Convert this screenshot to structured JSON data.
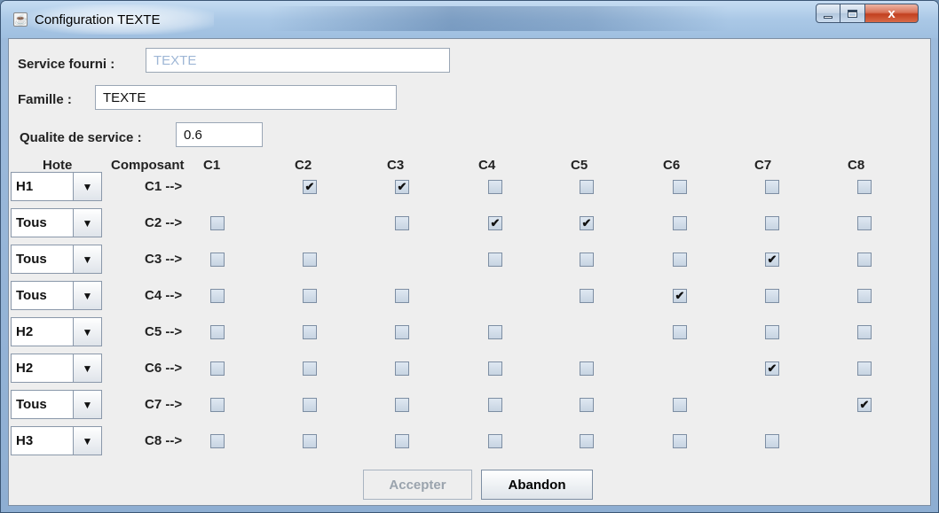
{
  "window": {
    "title": "Configuration TEXTE",
    "close_glyph": "x",
    "icons": [
      "java-app-icon",
      "minimize-icon",
      "maximize-icon",
      "close-icon"
    ]
  },
  "form": {
    "service_label": "Service fourni :",
    "service_value": "TEXTE",
    "famille_label": "Famille :",
    "famille_value": "TEXTE",
    "qualite_label": "Qualite de service :",
    "qualite_value": "0.6"
  },
  "grid": {
    "hote_header": "Hote",
    "composant_header": "Composant",
    "columns": [
      "C1",
      "C2",
      "C3",
      "C4",
      "C5",
      "C6",
      "C7",
      "C8"
    ],
    "rows": [
      {
        "hote": "H1",
        "label": "C1 -->",
        "checks": [
          null,
          true,
          true,
          false,
          false,
          false,
          false,
          false
        ]
      },
      {
        "hote": "Tous",
        "label": "C2 -->",
        "checks": [
          false,
          null,
          false,
          true,
          true,
          false,
          false,
          false
        ]
      },
      {
        "hote": "Tous",
        "label": "C3 -->",
        "checks": [
          false,
          false,
          null,
          false,
          false,
          false,
          true,
          false
        ]
      },
      {
        "hote": "Tous",
        "label": "C4 -->",
        "checks": [
          false,
          false,
          false,
          null,
          false,
          true,
          false,
          false
        ]
      },
      {
        "hote": "H2",
        "label": "C5 -->",
        "checks": [
          false,
          false,
          false,
          false,
          null,
          false,
          false,
          false
        ]
      },
      {
        "hote": "H2",
        "label": "C6 -->",
        "checks": [
          false,
          false,
          false,
          false,
          false,
          null,
          true,
          false
        ]
      },
      {
        "hote": "Tous",
        "label": "C7 -->",
        "checks": [
          false,
          false,
          false,
          false,
          false,
          false,
          null,
          true
        ]
      },
      {
        "hote": "H3",
        "label": "C8 -->",
        "checks": [
          false,
          false,
          false,
          false,
          false,
          false,
          false,
          null
        ]
      }
    ],
    "check_glyph": "✔"
  },
  "buttons": {
    "accept_label": "Accepter",
    "accept_enabled": false,
    "cancel_label": "Abandon"
  },
  "colors": {
    "panel_bg": "#eeeeee",
    "title_gradient_top": "#c6dcf2",
    "close_red": "#c2401f",
    "disabled_text": "#9fb7d6"
  }
}
